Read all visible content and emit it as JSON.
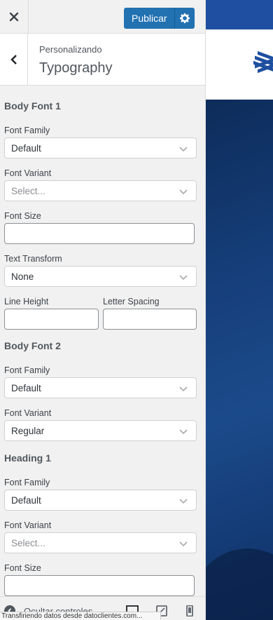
{
  "header": {
    "publish_label": "Publicar"
  },
  "section": {
    "subtitle": "Personalizando",
    "title": "Typography"
  },
  "body_font_1": {
    "title": "Body Font 1",
    "font_family_label": "Font Family",
    "font_family_value": "Default",
    "font_variant_label": "Font Variant",
    "font_variant_placeholder": "Select...",
    "font_size_label": "Font Size",
    "font_size_value": "",
    "text_transform_label": "Text Transform",
    "text_transform_value": "None",
    "line_height_label": "Line Height",
    "line_height_value": "",
    "letter_spacing_label": "Letter Spacing",
    "letter_spacing_value": ""
  },
  "body_font_2": {
    "title": "Body Font 2",
    "font_family_label": "Font Family",
    "font_family_value": "Default",
    "font_variant_label": "Font Variant",
    "font_variant_value": "Regular"
  },
  "heading_1": {
    "title": "Heading 1",
    "font_family_label": "Font Family",
    "font_family_value": "Default",
    "font_variant_label": "Font Variant",
    "font_variant_placeholder": "Select...",
    "font_size_label": "Font Size",
    "font_size_value": ""
  },
  "footer": {
    "hide_controls_label": "Ocultar controles",
    "status_text": "Transfiriendo datos desde datoclientes.com..."
  },
  "colors": {
    "publish_button": "#2271b1",
    "preview_topbar": "#1e4fa0",
    "sidebar_bg": "#f1f1f1"
  }
}
